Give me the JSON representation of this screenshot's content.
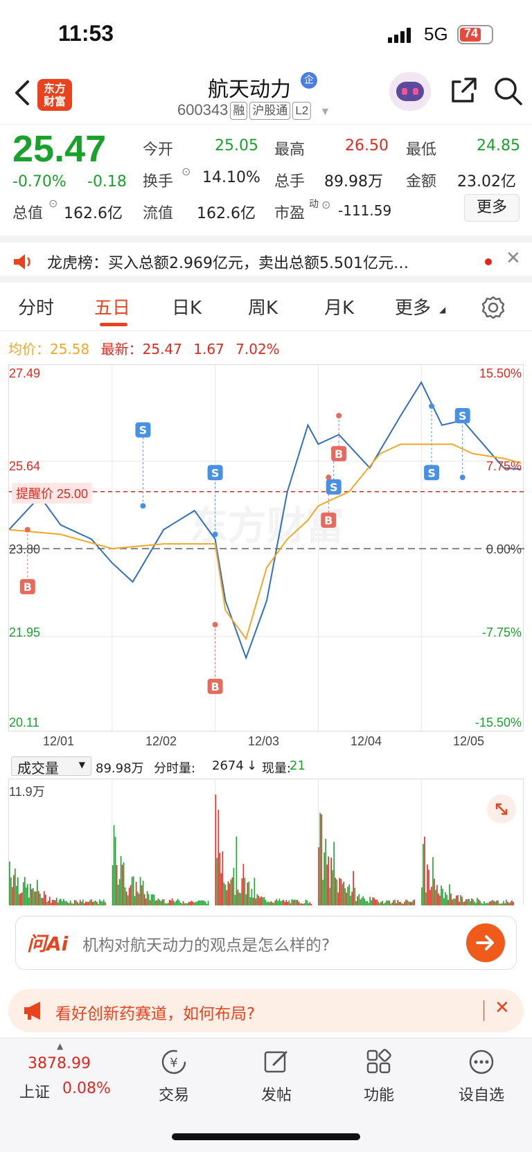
{
  "status": {
    "time": "11:53",
    "network": "5G",
    "battery": "74"
  },
  "header": {
    "title": "航天动力",
    "title_badge": "企",
    "code": "600343",
    "tags": [
      "融",
      "沪股通",
      "L2"
    ],
    "logo_line1": "东方",
    "logo_line2": "财富"
  },
  "quote": {
    "price": "25.47",
    "change_pct": "-0.70%",
    "change": "-0.18",
    "open_label": "今开",
    "open": "25.05",
    "high_label": "最高",
    "high": "26.50",
    "low_label": "最低",
    "low": "24.85",
    "turnover_label": "换手",
    "turnover": "14.10%",
    "volume_label": "总手",
    "volume": "89.98万",
    "amount_label": "金额",
    "amount": "23.02亿",
    "mcap_label": "总值",
    "mcap": "162.6亿",
    "float_label": "流值",
    "float": "162.6亿",
    "pe_label": "市盈",
    "pe_sup": "动",
    "pe": "-111.59",
    "more": "更多"
  },
  "news": {
    "text": "龙虎榜：买入总额2.969亿元，卖出总额5.501亿元…"
  },
  "tabs": [
    "分时",
    "五日",
    "日K",
    "周K",
    "月K",
    "更多"
  ],
  "active_tab": "五日",
  "chart_info": {
    "avg_label": "均价：",
    "avg": "25.58",
    "last_label": "最新：",
    "last": "25.47",
    "chg": "1.67",
    "chg_pct": "7.02%"
  },
  "chart_data": {
    "type": "line",
    "y_ticks_left": [
      "27.49",
      "25.64",
      "23.80",
      "21.95",
      "20.11"
    ],
    "y_ticks_right": [
      "15.50%",
      "7.75%",
      "0.00%",
      "-7.75%",
      "-15.50%"
    ],
    "x_ticks": [
      "12/01",
      "12/02",
      "12/03",
      "12/04",
      "12/05"
    ],
    "ylim": [
      20.11,
      27.49
    ],
    "alert_label": "提醒价 25.00",
    "alert_price": 25.0,
    "watermark": "东方财富",
    "series": [
      {
        "name": "价格",
        "color": "#2f6fbf",
        "x": [
          0,
          0.3,
          0.5,
          0.8,
          1.0,
          1.2,
          1.5,
          1.8,
          2.0,
          2.1,
          2.3,
          2.5,
          2.7,
          2.9,
          3.0,
          3.2,
          3.5,
          3.8,
          4.0,
          4.2,
          4.4,
          4.6,
          4.8,
          4.97
        ],
        "values": [
          24.2,
          24.9,
          24.3,
          24.0,
          23.5,
          23.1,
          24.2,
          24.6,
          24.0,
          22.7,
          21.5,
          22.7,
          25.0,
          26.4,
          26.0,
          26.2,
          25.5,
          26.6,
          27.3,
          26.4,
          26.5,
          26.0,
          25.5,
          25.47
        ]
      },
      {
        "name": "均价",
        "color": "#f5a623",
        "x": [
          0,
          0.5,
          1.0,
          1.5,
          2.0,
          2.1,
          2.3,
          2.5,
          2.7,
          2.9,
          3.0,
          3.3,
          3.6,
          3.8,
          4.0,
          4.3,
          4.5,
          4.8,
          4.97
        ],
        "values": [
          24.2,
          24.1,
          23.8,
          23.9,
          23.9,
          22.5,
          21.9,
          23.4,
          24.0,
          24.4,
          24.7,
          25.0,
          25.8,
          26.0,
          26.0,
          26.0,
          25.8,
          25.7,
          25.6
        ]
      }
    ],
    "markers": [
      {
        "type": "B",
        "x": 0.18,
        "price": 24.2,
        "label_price": 23.0
      },
      {
        "type": "S",
        "x": 1.3,
        "price": 24.7,
        "label_price": 26.3
      },
      {
        "type": "S",
        "x": 2.0,
        "price": 24.1,
        "label_price": 25.4
      },
      {
        "type": "B",
        "x": 2.0,
        "price": 22.2,
        "label_price": 20.9
      },
      {
        "type": "B",
        "x": 3.1,
        "price": 25.3,
        "label_price": 24.4
      },
      {
        "type": "S",
        "x": 3.15,
        "price": 25.9,
        "label_price": 25.1
      },
      {
        "type": "B",
        "x": 3.2,
        "price": 26.6,
        "label_price": 25.8
      },
      {
        "type": "S",
        "x": 4.1,
        "price": 26.8,
        "label_price": 25.4
      },
      {
        "type": "S",
        "x": 4.4,
        "price": 25.3,
        "label_price": 26.6
      }
    ]
  },
  "volume": {
    "selector": "成交量",
    "total": "89.98万",
    "tick_label": "分时量:",
    "tick": "2674",
    "arrow": "↓",
    "now_label": "现量:",
    "now": "21",
    "max": "11.9万"
  },
  "ask": {
    "brand": "问Ai",
    "placeholder": "机构对航天动力的观点是怎么样的?"
  },
  "promo": {
    "text": "看好创新药赛道，如何布局?"
  },
  "bottom": {
    "index_value": "3878.99",
    "index_name": "上证",
    "index_pct": "0.08%",
    "items": [
      "交易",
      "发帖",
      "功能",
      "设自选"
    ]
  }
}
